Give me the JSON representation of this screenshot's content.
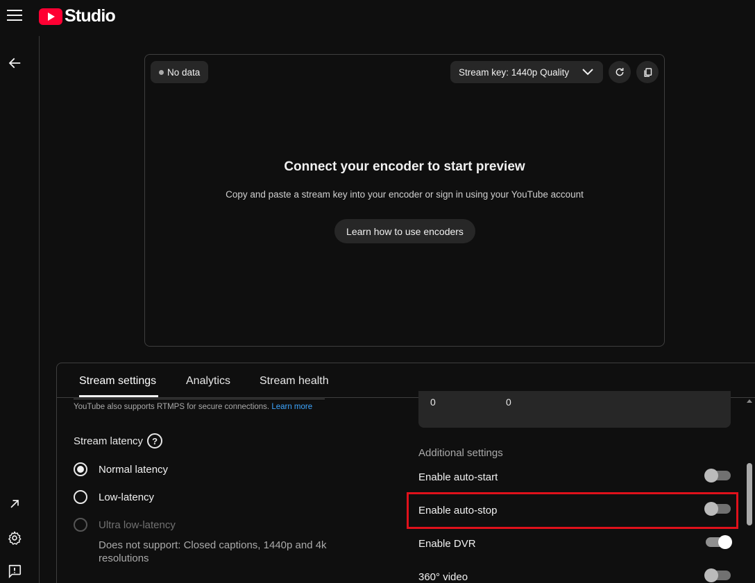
{
  "app": {
    "logo_text": "Studio"
  },
  "preview": {
    "status": "No data",
    "stream_key_label": "Stream key: 1440p Quality",
    "title": "Connect your encoder to start preview",
    "subtitle": "Copy and paste a stream key into your encoder or sign in using your YouTube account",
    "learn_button": "Learn how to use encoders"
  },
  "tabs": [
    {
      "label": "Stream settings",
      "active": true
    },
    {
      "label": "Analytics",
      "active": false
    },
    {
      "label": "Stream health",
      "active": false
    }
  ],
  "stream_settings": {
    "rtmps_text": "YouTube also supports RTMPS for secure connections.",
    "rtmps_link": "Learn more",
    "latency_title": "Stream latency",
    "latency_options": [
      {
        "label": "Normal latency",
        "checked": true,
        "disabled": false
      },
      {
        "label": "Low-latency",
        "checked": false,
        "disabled": false
      },
      {
        "label": "Ultra low-latency",
        "checked": false,
        "disabled": true
      }
    ],
    "ultra_note": "Does not support: Closed captions, 1440p and 4k resolutions"
  },
  "stats": {
    "values": [
      "0",
      "0"
    ]
  },
  "additional_settings": {
    "title": "Additional settings",
    "toggles": [
      {
        "label": "Enable auto-start",
        "on": false
      },
      {
        "label": "Enable auto-stop",
        "on": false,
        "highlighted": true
      },
      {
        "label": "Enable DVR",
        "on": true
      },
      {
        "label": "360° video",
        "on": false
      }
    ]
  },
  "colors": {
    "background": "#0f0f0f",
    "surface": "#272727",
    "brand_red": "#ff0033",
    "highlight_red": "#e0111b",
    "link_blue": "#3ea6ff"
  },
  "icons": {
    "menu": "hamburger-menu-icon",
    "back": "arrow-left-icon",
    "external": "arrow-up-right-icon",
    "settings": "gear-icon",
    "feedback": "feedback-icon",
    "refresh": "refresh-icon",
    "copy": "copy-icon",
    "dropdown": "chevron-down-icon",
    "help": "question-circle-icon"
  }
}
